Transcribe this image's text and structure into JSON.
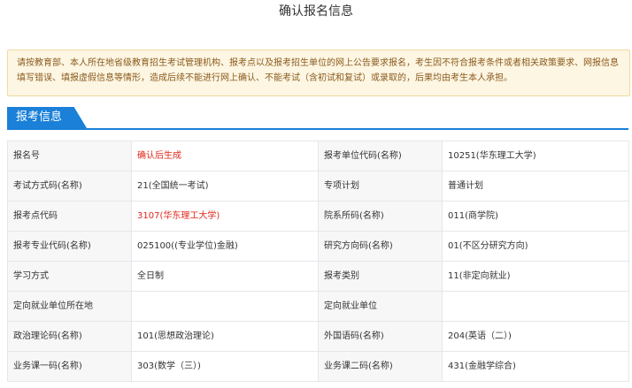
{
  "page_title": "确认报名信息",
  "notice": "请按教育部、本人所在地省级教育招生考试管理机构、报考点以及报考招生单位的网上公告要求报名，考生因不符合报考条件或者相关政策要求、网报信息填写错误、填报虚假信息等情形，造成后续不能进行网上确认、不能考试（含初试和复试）或录取的，后果均由考生本人承担。",
  "section_title": "报考信息",
  "colors": {
    "accent": "#1a80d8",
    "highlight_red": "#e0271b",
    "notice_bg": "#fdf6e3"
  },
  "rows": [
    {
      "l1": "报名号",
      "v1": "确认后生成",
      "l2": "报考单位代码(名称)",
      "v2": "10251(华东理工大学)"
    },
    {
      "l1": "考试方式码(名称)",
      "v1": "21(全国统一考试)",
      "l2": "专项计划",
      "v2": "普通计划"
    },
    {
      "l1": "报考点代码",
      "v1": "3107(华东理工大学)",
      "l2": "院系所码(名称)",
      "v2": "011(商学院)"
    },
    {
      "l1": "报考专业代码(名称)",
      "v1": "025100((专业学位)金融)",
      "l2": "研究方向码(名称)",
      "v2": "01(不区分研究方向)"
    },
    {
      "l1": "学习方式",
      "v1": "全日制",
      "l2": "报考类别",
      "v2": "11(非定向就业)"
    },
    {
      "l1": "定向就业单位所在地",
      "v1": "",
      "l2": "定向就业单位",
      "v2": ""
    },
    {
      "l1": "政治理论码(名称)",
      "v1": "101(思想政治理论)",
      "l2": "外国语码(名称)",
      "v2": "204(英语（二）)"
    },
    {
      "l1": "业务课一码(名称)",
      "v1": "303(数学（三）)",
      "l2": "业务课二码(名称)",
      "v2": "431(金融学综合)"
    }
  ]
}
